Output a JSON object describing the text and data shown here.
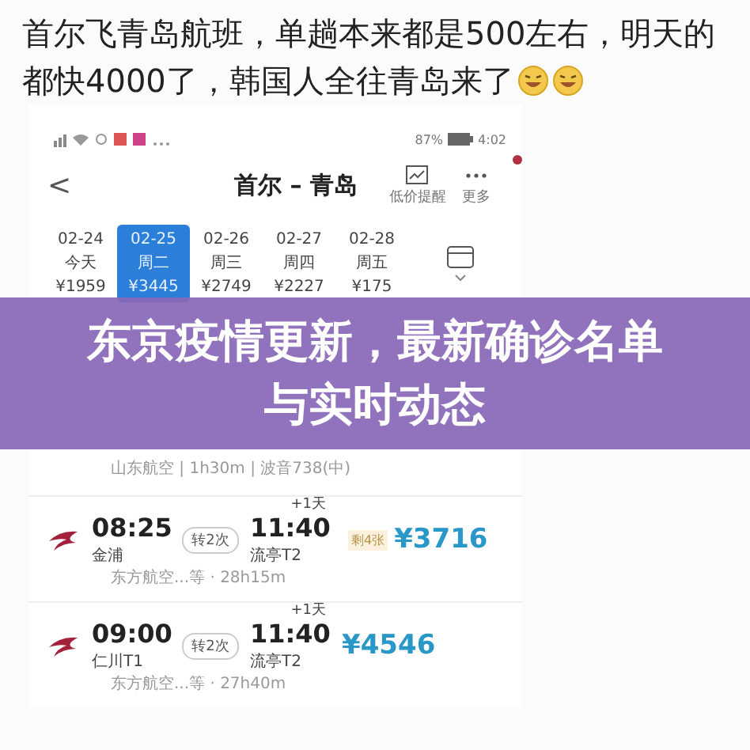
{
  "post": {
    "lines": [
      "首尔飞青岛航班，单趟本来都是500左右，明天的",
      "都快4000了，韩国人全往青岛来了"
    ]
  },
  "status_bar": {
    "battery": "87%",
    "time": "4:02"
  },
  "header": {
    "back": "<",
    "title": "首尔 – 青岛",
    "actions": [
      {
        "kind": "alert",
        "label": "低价提醒"
      },
      {
        "kind": "more",
        "label": "更多"
      }
    ]
  },
  "dates": [
    {
      "date": "02-24",
      "weekday": "今天",
      "price": "¥1959",
      "selected": false
    },
    {
      "date": "02-25",
      "weekday": "周二",
      "price": "¥3445",
      "selected": true
    },
    {
      "date": "02-26",
      "weekday": "周三",
      "price": "¥2749",
      "selected": false
    },
    {
      "date": "02-27",
      "weekday": "周四",
      "price": "¥2227",
      "selected": false
    },
    {
      "date": "02-28",
      "weekday": "周五",
      "price": "¥175",
      "selected": false
    }
  ],
  "banner": {
    "title": "东京疫情更新，最新确诊名单与实时动态"
  },
  "flights": [
    {
      "kind": "partial",
      "details": "山东航空 | 1h30m | 波音738(中)"
    },
    {
      "kind": "full",
      "dep_time": "08:25",
      "dep_airport": "金浦",
      "stops": "转2次",
      "arr_time": "11:40",
      "next_day": "+1天",
      "arr_airport": "流亭T2",
      "seats": "剩4张",
      "price": "¥3716",
      "details": "东方航空...等 · 28h15m"
    },
    {
      "kind": "full",
      "dep_time": "09:00",
      "dep_airport": "仁川T1",
      "stops": "转2次",
      "arr_time": "11:40",
      "next_day": "+1天",
      "arr_airport": "流亭T2",
      "price": "¥4546",
      "details": "东方航空...等 · 27h40m"
    }
  ]
}
